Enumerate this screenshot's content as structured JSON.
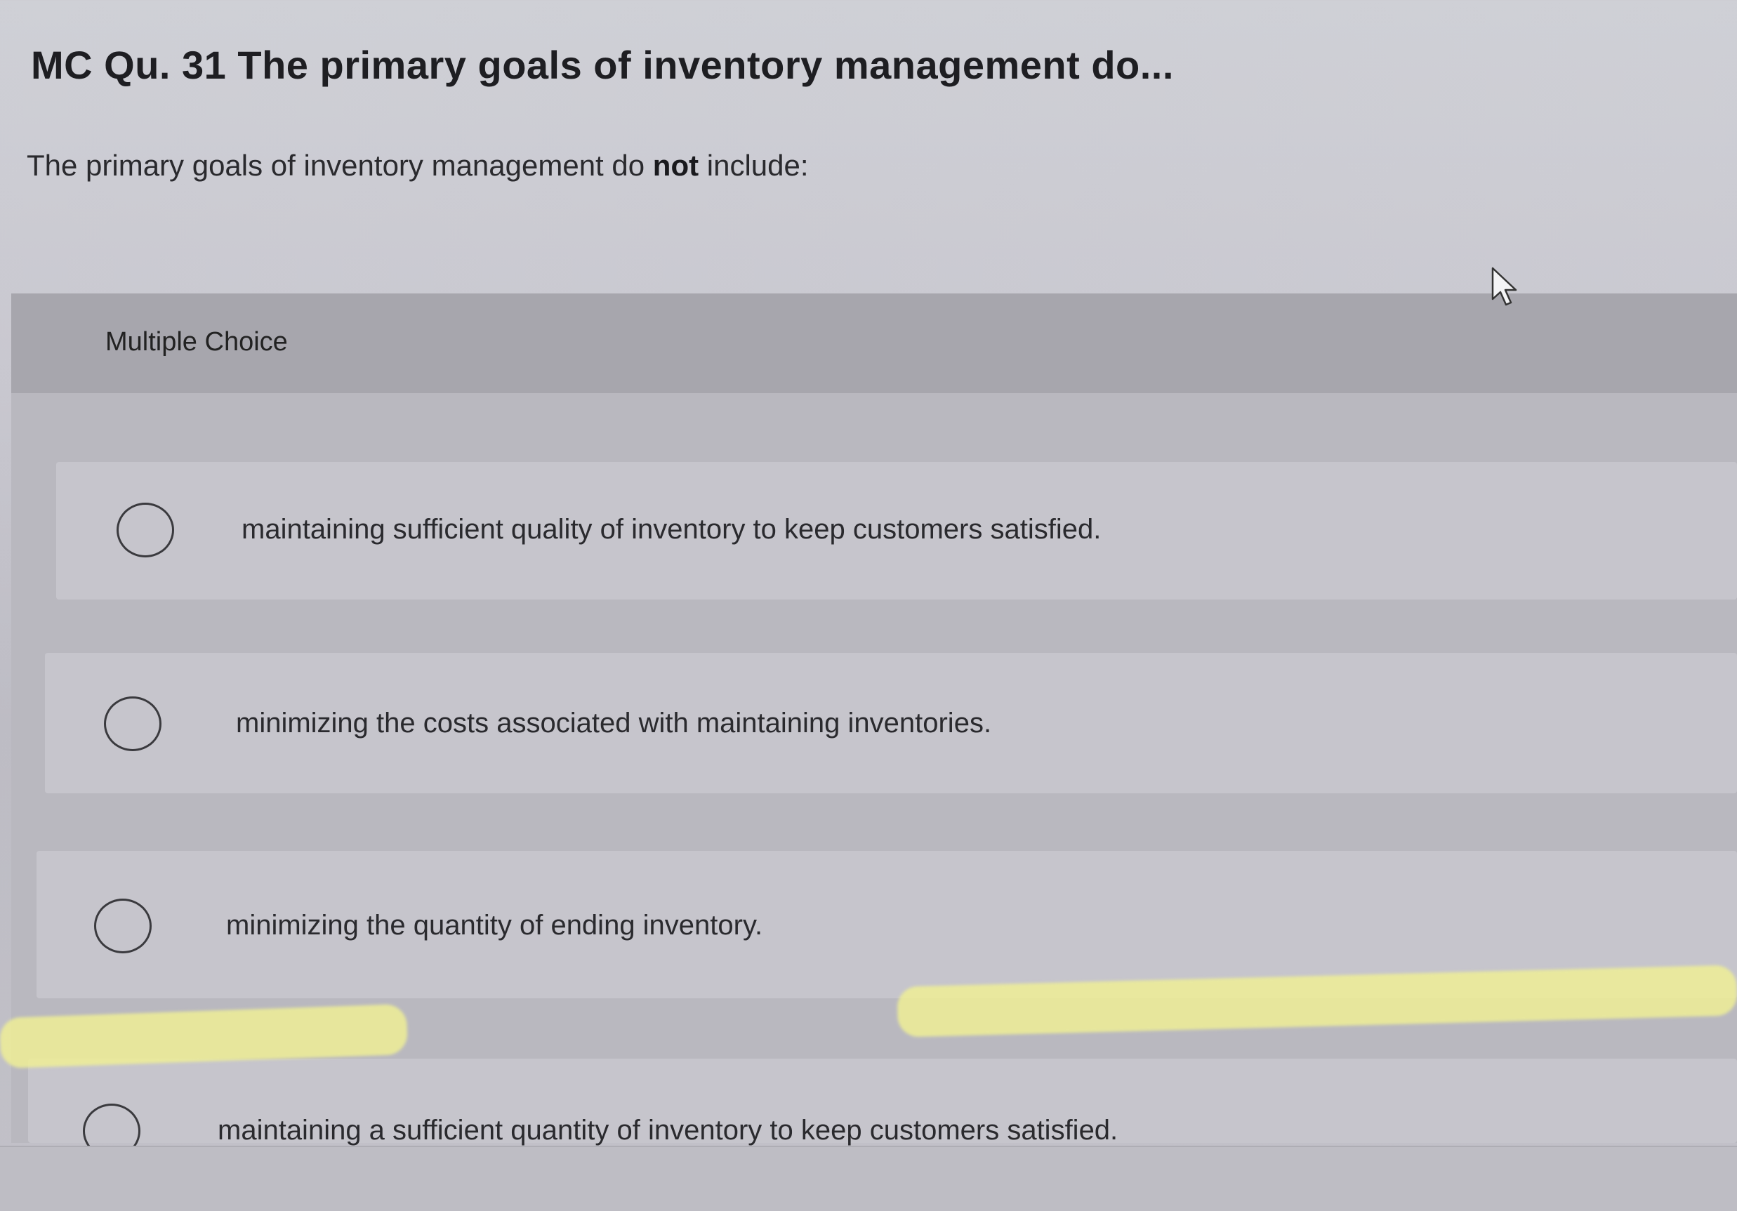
{
  "question": {
    "title": "MC Qu. 31 The primary goals of inventory management do...",
    "prompt_before": "The primary goals of inventory management do ",
    "prompt_emphasis": "not",
    "prompt_after": " include:"
  },
  "section": {
    "header_label": "Multiple Choice"
  },
  "options": [
    {
      "label": "maintaining sufficient quality of inventory to keep customers satisfied."
    },
    {
      "label": "minimizing the costs associated with maintaining inventories."
    },
    {
      "label": "minimizing the quantity of ending inventory."
    },
    {
      "label": "maintaining a sufficient quantity of inventory to keep customers satisfied."
    }
  ],
  "icons": {
    "cursor": "mouse-pointer-icon",
    "radio": "radio-button-icon"
  },
  "colors": {
    "header_band": "#a7a6ad",
    "option_bg": "#c6c5cc",
    "text": "#222222"
  }
}
